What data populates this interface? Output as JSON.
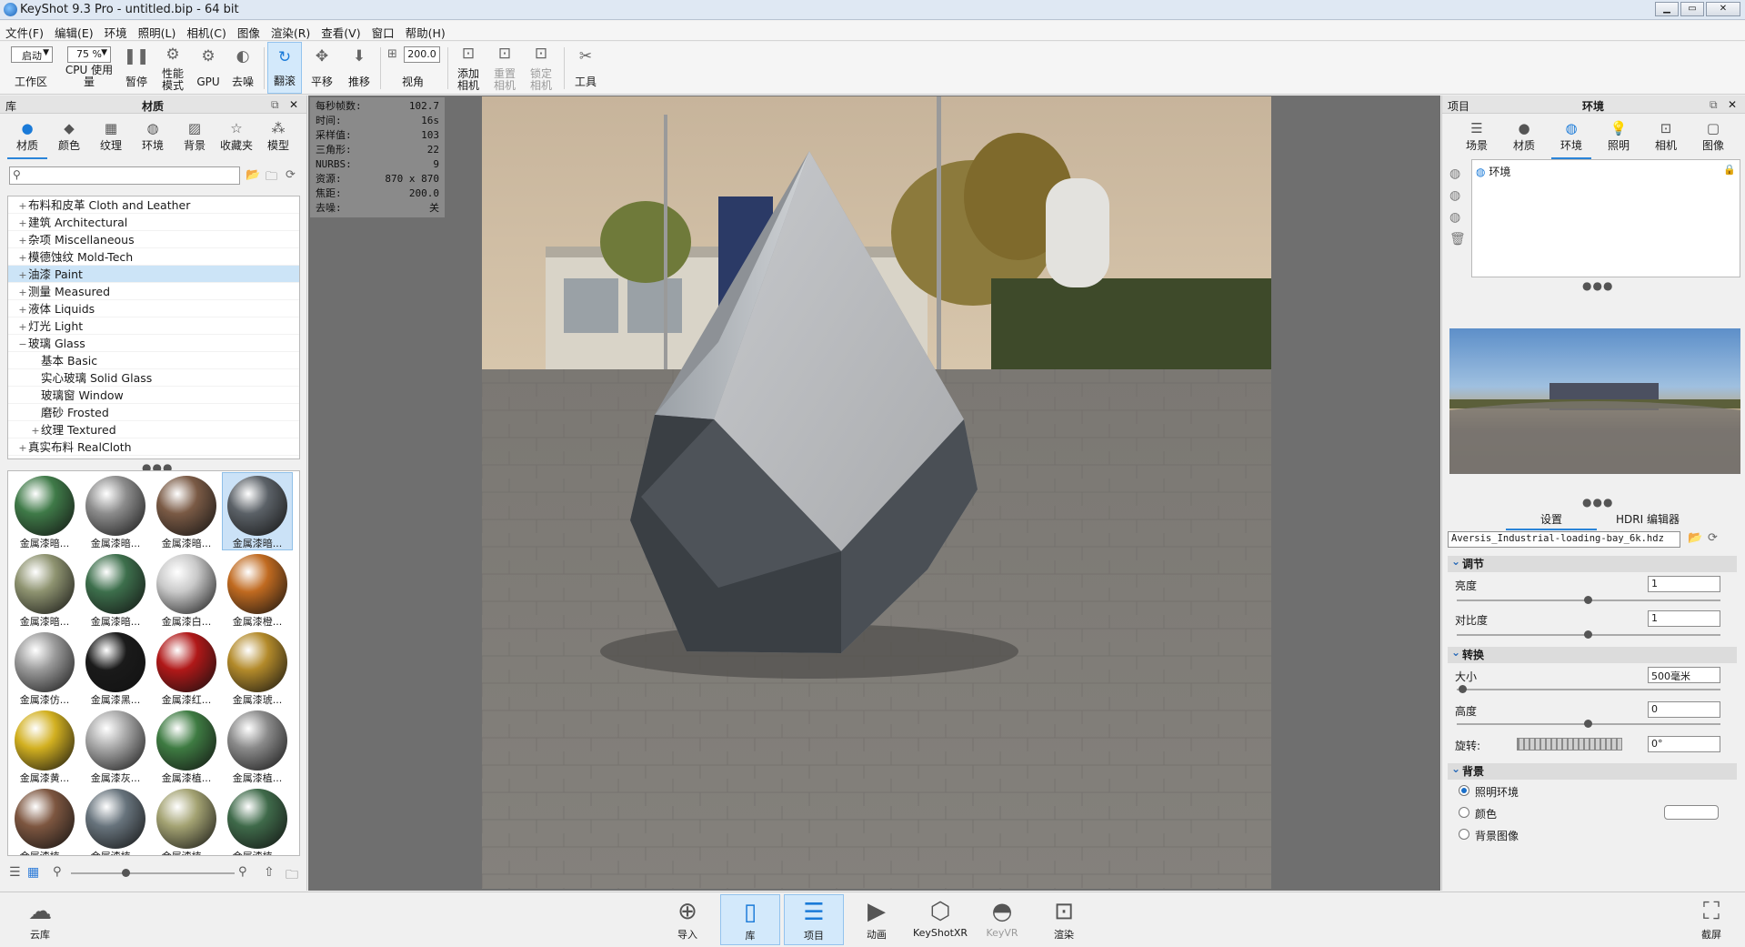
{
  "window": {
    "title": "KeyShot 9.3 Pro  - untitled.bip  - 64 bit",
    "min": "▁",
    "max": "▭",
    "close": "✕"
  },
  "menu": [
    "文件(F)",
    "编辑(E)",
    "环境",
    "照明(L)",
    "相机(C)",
    "图像",
    "渲染(R)",
    "查看(V)",
    "窗口",
    "帮助(H)"
  ],
  "ribbon": {
    "workspace_value": "启动",
    "workspace_label": "工作区",
    "cpu_value": "75 %",
    "cpu_label": "CPU 使用量",
    "pause": "暂停",
    "perf": "性能\n模式",
    "gpu": "GPU",
    "denoise": "去噪",
    "tumble": "翻滚",
    "pan": "平移",
    "dolly": "推移",
    "fov_value": "200.0",
    "fov_label": "视角",
    "add_camera": "添加\n相机",
    "reset_camera": "重置\n相机",
    "lock_camera": "锁定\n相机",
    "tools": "工具"
  },
  "library": {
    "header_left": "库",
    "header_title": "材质",
    "dock": "⧉",
    "close": "✕",
    "tabs": [
      "材质",
      "颜色",
      "纹理",
      "环境",
      "背景",
      "收藏夹",
      "模型"
    ],
    "search_placeholder": "",
    "tree": [
      {
        "pm": "+",
        "label": "布料和皮革 Cloth and Leather",
        "indent": 0
      },
      {
        "pm": "+",
        "label": "建筑 Architectural",
        "indent": 0
      },
      {
        "pm": "+",
        "label": "杂项 Miscellaneous",
        "indent": 0
      },
      {
        "pm": "+",
        "label": "模德蚀纹 Mold-Tech",
        "indent": 0
      },
      {
        "pm": "+",
        "label": "油漆 Paint",
        "indent": 0,
        "sel": true
      },
      {
        "pm": "+",
        "label": "测量 Measured",
        "indent": 0
      },
      {
        "pm": "+",
        "label": "液体 Liquids",
        "indent": 0
      },
      {
        "pm": "+",
        "label": "灯光 Light",
        "indent": 0
      },
      {
        "pm": "−",
        "label": "玻璃 Glass",
        "indent": 0
      },
      {
        "pm": "",
        "label": "基本 Basic",
        "indent": 1
      },
      {
        "pm": "",
        "label": "实心玻璃 Solid Glass",
        "indent": 1
      },
      {
        "pm": "",
        "label": "玻璃窗 Window",
        "indent": 1
      },
      {
        "pm": "",
        "label": "磨砂 Frosted",
        "indent": 1
      },
      {
        "pm": "+",
        "label": "纹理 Textured",
        "indent": 1
      },
      {
        "pm": "+",
        "label": "真实布料 RealCloth",
        "indent": 0
      }
    ],
    "thumbs": [
      {
        "label": "金属漆暗...",
        "color": "#3f7a48"
      },
      {
        "label": "金属漆暗...",
        "color": "#8c8c8c"
      },
      {
        "label": "金属漆暗...",
        "color": "#7a5a45"
      },
      {
        "label": "金属漆暗...",
        "color": "#5b6167",
        "sel": true
      },
      {
        "label": "金属漆暗...",
        "color": "#8e9370"
      },
      {
        "label": "金属漆暗...",
        "color": "#3d6f4c"
      },
      {
        "label": "金属漆白...",
        "color": "#c9c9c9"
      },
      {
        "label": "金属漆橙...",
        "color": "#c06a20"
      },
      {
        "label": "金属漆仿...",
        "color": "#9a9a9a"
      },
      {
        "label": "金属漆黑...",
        "color": "#1a1a1a"
      },
      {
        "label": "金属漆红...",
        "color": "#b01818"
      },
      {
        "label": "金属漆琥...",
        "color": "#b38a2a"
      },
      {
        "label": "金属漆黄...",
        "color": "#d2b020"
      },
      {
        "label": "金属漆灰...",
        "color": "#a8a8a8"
      },
      {
        "label": "金属漆植...",
        "color": "#3e7b42"
      },
      {
        "label": "金属漆植...",
        "color": "#8a8a8a"
      },
      {
        "label": "金属漆植...",
        "color": "#7d5640"
      },
      {
        "label": "金属漆植...",
        "color": "#67737c"
      },
      {
        "label": "金属漆植...",
        "color": "#a3a272"
      },
      {
        "label": "金属漆植...",
        "color": "#3f6a4a"
      }
    ]
  },
  "stats": [
    {
      "k": "每秒帧数:",
      "v": "102.7"
    },
    {
      "k": "时间:",
      "v": "16s"
    },
    {
      "k": "采样值:",
      "v": "103"
    },
    {
      "k": "三角形:",
      "v": "22"
    },
    {
      "k": "NURBS:",
      "v": "9"
    },
    {
      "k": "资源:",
      "v": "870 x 870"
    },
    {
      "k": "焦距:",
      "v": "200.0"
    },
    {
      "k": "去噪:",
      "v": "关"
    }
  ],
  "project": {
    "header_left": "项目",
    "header_title": "环境",
    "dock": "⧉",
    "close": "✕",
    "tabs": [
      "场景",
      "材质",
      "环境",
      "照明",
      "相机",
      "图像"
    ],
    "env_item": "环境",
    "subtabs": [
      "设置",
      "HDRI 编辑器"
    ],
    "hdr_file": "Aversis_Industrial-loading-bay_6k.hdz",
    "sections": {
      "adjust": "调节",
      "brightness": "亮度",
      "brightness_value": "1",
      "contrast": "对比度",
      "contrast_value": "1",
      "transform": "转换",
      "size": "大小",
      "size_value": "500毫米",
      "height": "高度",
      "height_value": "0",
      "rotation": "旋转:",
      "rotation_value": "0°",
      "background": "背景",
      "bg_lighting": "照明环境",
      "bg_color": "颜色",
      "bg_image": "背景图像"
    }
  },
  "bottom": {
    "cloud": "云库",
    "import": "导入",
    "library": "库",
    "project": "项目",
    "animation": "动画",
    "keyshotxr": "KeyShotXR",
    "keyvr": "KeyVR",
    "render": "渲染",
    "screenshot": "截屏"
  }
}
